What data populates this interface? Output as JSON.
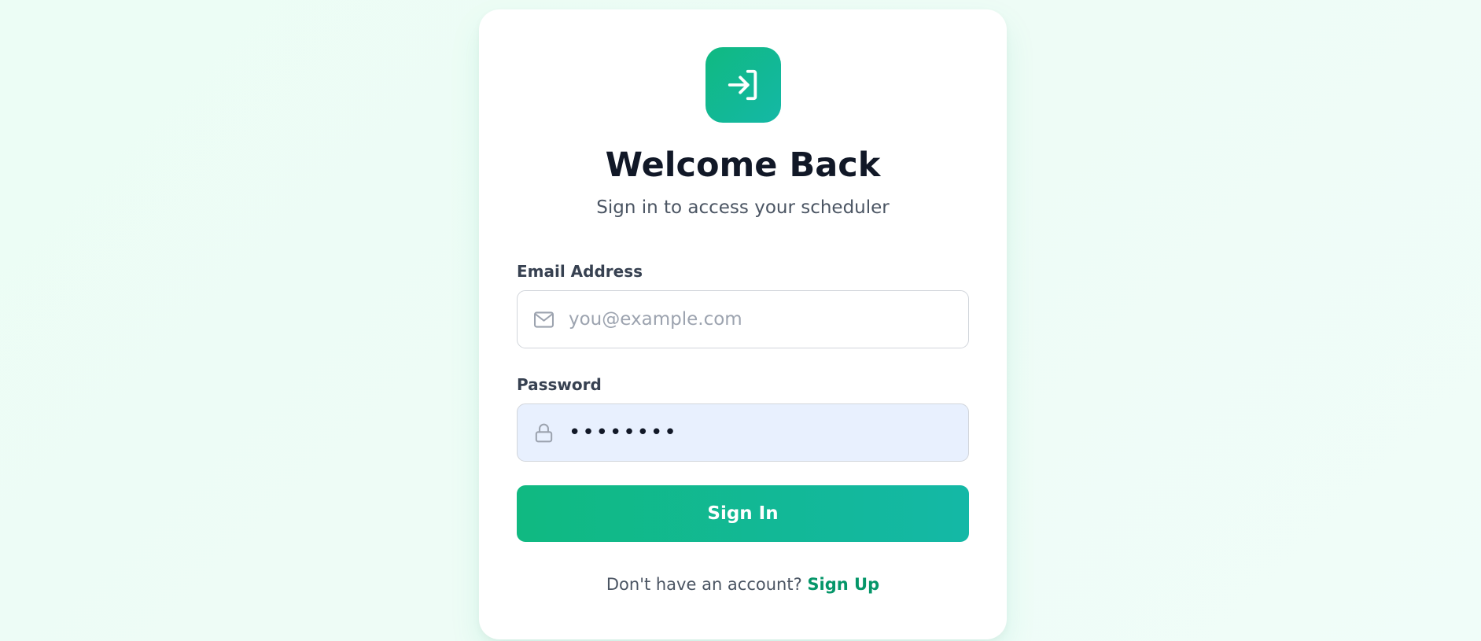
{
  "header": {
    "title": "Welcome Back",
    "subtitle": "Sign in to access your scheduler",
    "logo_icon": "login-arrow-icon"
  },
  "form": {
    "email": {
      "label": "Email Address",
      "placeholder": "you@example.com",
      "value": "",
      "icon": "mail-icon"
    },
    "password": {
      "label": "Password",
      "value": "••••••••",
      "icon": "lock-icon"
    },
    "submit_label": "Sign In"
  },
  "footer": {
    "prompt": "Don't have an account?",
    "link_label": "Sign Up"
  },
  "colors": {
    "accent": "#10b981",
    "accent_end": "#14b8a6",
    "link": "#059669",
    "autofill_bg": "#e8f0fe"
  }
}
